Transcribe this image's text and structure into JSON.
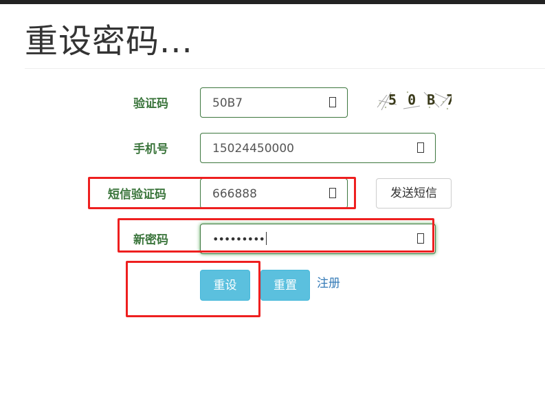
{
  "page": {
    "title": "重设密码..."
  },
  "form": {
    "captcha": {
      "label": "验证码",
      "value": "50B7",
      "image_text": "5 0 B 7"
    },
    "phone": {
      "label": "手机号",
      "value": "15024450000"
    },
    "sms_code": {
      "label": "短信验证码",
      "value": "666888",
      "send_button": "发送短信"
    },
    "new_password": {
      "label": "新密码",
      "value": "•••••••••"
    },
    "actions": {
      "reset_submit": "重设",
      "reset_clear": "重置",
      "register_link": "注册"
    }
  },
  "colors": {
    "label_green": "#3c763d",
    "input_border": "#3c763d",
    "button_info": "#5bc0de",
    "link_blue": "#337ab7",
    "annotation_red": "#ee1f1f"
  }
}
